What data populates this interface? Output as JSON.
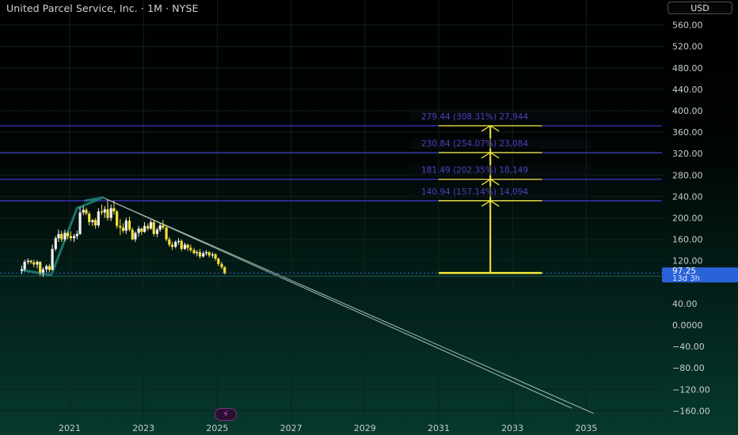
{
  "header": {
    "symbol_title": "United Parcel Service, Inc. · 1M · NYSE",
    "currency": "USD"
  },
  "colors": {
    "grid": "#12211c",
    "axis_text": "#c8ccd0",
    "candle_up": "#f2f2f2",
    "candle_down": "#f2df3a",
    "fib_line": "#3d34c8",
    "fib_label": "#4a40c4",
    "projection": "#f6e83c",
    "trendline": "#9cb3ad",
    "teal_pattern": "#1e7f73",
    "price_badge": "#2a62d8"
  },
  "icons": {
    "tv_logo": "lightning-icon"
  },
  "chart_data": {
    "type": "candlestick",
    "title": "United Parcel Service, Inc. · 1M · NYSE",
    "y_ticks": [
      "560.00",
      "520.00",
      "480.00",
      "440.00",
      "400.00",
      "360.00",
      "320.00",
      "280.00",
      "240.00",
      "200.00",
      "160.00",
      "120.00",
      "40.00",
      "0.0000",
      "−40.00",
      "−80.00",
      "−120.00",
      "−160.00"
    ],
    "x_ticks": [
      "2021",
      "2023",
      "2025",
      "2027",
      "2029",
      "2031",
      "2033",
      "2035"
    ],
    "ylim": [
      -170,
      590
    ],
    "grid": true,
    "last_price": {
      "value": "97.25",
      "countdown": "13d 3h"
    },
    "fib_levels": [
      {
        "price": 372,
        "label": "279.44 (308.31%) 27,944"
      },
      {
        "price": 322,
        "label": "230.84 (254.07%) 23,084"
      },
      {
        "price": 272,
        "label": "181.49 (202.35%) 18,149"
      },
      {
        "price": 232,
        "label": "140.94 (157.14%) 14,094"
      }
    ],
    "projection": {
      "x_from": 2031.0,
      "x_to": 2033.8,
      "x_mid": 2032.4,
      "base": 97.25,
      "levels": [
        232,
        272,
        322,
        372
      ]
    },
    "trendlines": [
      {
        "x1": 2021.9,
        "y1": 238,
        "x2": 2034.6,
        "y2": -155
      },
      {
        "x1": 2021.9,
        "y1": 238,
        "x2": 2035.2,
        "y2": -165
      }
    ],
    "teal_pattern": [
      [
        2019.7,
        103
      ],
      [
        2020.5,
        93
      ],
      [
        2021.2,
        218
      ],
      [
        2021.9,
        238
      ],
      [
        2021.4,
        232
      ]
    ],
    "candles": [
      {
        "t": 2019.7,
        "o": 101,
        "h": 111,
        "l": 95,
        "c": 104
      },
      {
        "t": 2019.78,
        "o": 104,
        "h": 122,
        "l": 100,
        "c": 118
      },
      {
        "t": 2019.87,
        "o": 118,
        "h": 124,
        "l": 113,
        "c": 120
      },
      {
        "t": 2019.95,
        "o": 120,
        "h": 122,
        "l": 114,
        "c": 117
      },
      {
        "t": 2020.03,
        "o": 117,
        "h": 122,
        "l": 108,
        "c": 113
      },
      {
        "t": 2020.12,
        "o": 113,
        "h": 121,
        "l": 106,
        "c": 118
      },
      {
        "t": 2020.2,
        "o": 118,
        "h": 119,
        "l": 92,
        "c": 98
      },
      {
        "t": 2020.28,
        "o": 98,
        "h": 108,
        "l": 90,
        "c": 104
      },
      {
        "t": 2020.37,
        "o": 104,
        "h": 113,
        "l": 98,
        "c": 110
      },
      {
        "t": 2020.45,
        "o": 110,
        "h": 114,
        "l": 98,
        "c": 103
      },
      {
        "t": 2020.53,
        "o": 103,
        "h": 150,
        "l": 102,
        "c": 142
      },
      {
        "t": 2020.62,
        "o": 142,
        "h": 166,
        "l": 138,
        "c": 162
      },
      {
        "t": 2020.7,
        "o": 162,
        "h": 178,
        "l": 155,
        "c": 170
      },
      {
        "t": 2020.78,
        "o": 170,
        "h": 176,
        "l": 155,
        "c": 160
      },
      {
        "t": 2020.87,
        "o": 160,
        "h": 178,
        "l": 156,
        "c": 172
      },
      {
        "t": 2020.95,
        "o": 172,
        "h": 175,
        "l": 160,
        "c": 166
      },
      {
        "t": 2021.03,
        "o": 166,
        "h": 175,
        "l": 157,
        "c": 162
      },
      {
        "t": 2021.12,
        "o": 162,
        "h": 170,
        "l": 155,
        "c": 166
      },
      {
        "t": 2021.2,
        "o": 166,
        "h": 176,
        "l": 160,
        "c": 170
      },
      {
        "t": 2021.28,
        "o": 170,
        "h": 220,
        "l": 168,
        "c": 210
      },
      {
        "t": 2021.37,
        "o": 210,
        "h": 222,
        "l": 205,
        "c": 215
      },
      {
        "t": 2021.45,
        "o": 215,
        "h": 219,
        "l": 205,
        "c": 208
      },
      {
        "t": 2021.53,
        "o": 208,
        "h": 212,
        "l": 186,
        "c": 192
      },
      {
        "t": 2021.62,
        "o": 192,
        "h": 198,
        "l": 185,
        "c": 196
      },
      {
        "t": 2021.7,
        "o": 196,
        "h": 200,
        "l": 180,
        "c": 186
      },
      {
        "t": 2021.78,
        "o": 186,
        "h": 218,
        "l": 182,
        "c": 212
      },
      {
        "t": 2021.87,
        "o": 212,
        "h": 225,
        "l": 205,
        "c": 210
      },
      {
        "t": 2021.95,
        "o": 210,
        "h": 222,
        "l": 200,
        "c": 216
      },
      {
        "t": 2022.03,
        "o": 216,
        "h": 233,
        "l": 195,
        "c": 200
      },
      {
        "t": 2022.12,
        "o": 200,
        "h": 225,
        "l": 194,
        "c": 218
      },
      {
        "t": 2022.2,
        "o": 218,
        "h": 232,
        "l": 206,
        "c": 212
      },
      {
        "t": 2022.28,
        "o": 212,
        "h": 215,
        "l": 180,
        "c": 185
      },
      {
        "t": 2022.37,
        "o": 185,
        "h": 198,
        "l": 168,
        "c": 182
      },
      {
        "t": 2022.45,
        "o": 182,
        "h": 190,
        "l": 172,
        "c": 176
      },
      {
        "t": 2022.53,
        "o": 176,
        "h": 200,
        "l": 170,
        "c": 195
      },
      {
        "t": 2022.62,
        "o": 195,
        "h": 202,
        "l": 175,
        "c": 178
      },
      {
        "t": 2022.7,
        "o": 178,
        "h": 182,
        "l": 158,
        "c": 160
      },
      {
        "t": 2022.78,
        "o": 160,
        "h": 175,
        "l": 155,
        "c": 172
      },
      {
        "t": 2022.87,
        "o": 172,
        "h": 185,
        "l": 165,
        "c": 180
      },
      {
        "t": 2022.95,
        "o": 180,
        "h": 182,
        "l": 168,
        "c": 174
      },
      {
        "t": 2023.03,
        "o": 174,
        "h": 192,
        "l": 172,
        "c": 185
      },
      {
        "t": 2023.12,
        "o": 185,
        "h": 190,
        "l": 176,
        "c": 180
      },
      {
        "t": 2023.2,
        "o": 180,
        "h": 196,
        "l": 178,
        "c": 192
      },
      {
        "t": 2023.28,
        "o": 192,
        "h": 196,
        "l": 166,
        "c": 170
      },
      {
        "t": 2023.37,
        "o": 170,
        "h": 182,
        "l": 164,
        "c": 178
      },
      {
        "t": 2023.45,
        "o": 178,
        "h": 190,
        "l": 174,
        "c": 186
      },
      {
        "t": 2023.53,
        "o": 186,
        "h": 196,
        "l": 178,
        "c": 182
      },
      {
        "t": 2023.62,
        "o": 182,
        "h": 186,
        "l": 156,
        "c": 160
      },
      {
        "t": 2023.7,
        "o": 160,
        "h": 164,
        "l": 146,
        "c": 150
      },
      {
        "t": 2023.78,
        "o": 150,
        "h": 156,
        "l": 140,
        "c": 146
      },
      {
        "t": 2023.87,
        "o": 146,
        "h": 158,
        "l": 143,
        "c": 155
      },
      {
        "t": 2023.95,
        "o": 155,
        "h": 162,
        "l": 150,
        "c": 157
      },
      {
        "t": 2024.03,
        "o": 157,
        "h": 160,
        "l": 138,
        "c": 142
      },
      {
        "t": 2024.12,
        "o": 142,
        "h": 154,
        "l": 140,
        "c": 150
      },
      {
        "t": 2024.2,
        "o": 150,
        "h": 152,
        "l": 138,
        "c": 144
      },
      {
        "t": 2024.28,
        "o": 144,
        "h": 150,
        "l": 136,
        "c": 140
      },
      {
        "t": 2024.37,
        "o": 140,
        "h": 144,
        "l": 132,
        "c": 134
      },
      {
        "t": 2024.45,
        "o": 134,
        "h": 140,
        "l": 128,
        "c": 136
      },
      {
        "t": 2024.53,
        "o": 136,
        "h": 142,
        "l": 124,
        "c": 128
      },
      {
        "t": 2024.62,
        "o": 128,
        "h": 138,
        "l": 126,
        "c": 134
      },
      {
        "t": 2024.7,
        "o": 134,
        "h": 140,
        "l": 130,
        "c": 136
      },
      {
        "t": 2024.78,
        "o": 136,
        "h": 138,
        "l": 126,
        "c": 130
      },
      {
        "t": 2024.87,
        "o": 130,
        "h": 136,
        "l": 125,
        "c": 132
      },
      {
        "t": 2024.95,
        "o": 132,
        "h": 134,
        "l": 120,
        "c": 124
      },
      {
        "t": 2025.03,
        "o": 124,
        "h": 126,
        "l": 110,
        "c": 114
      },
      {
        "t": 2025.12,
        "o": 114,
        "h": 118,
        "l": 104,
        "c": 108
      },
      {
        "t": 2025.2,
        "o": 108,
        "h": 110,
        "l": 94,
        "c": 97
      }
    ]
  }
}
